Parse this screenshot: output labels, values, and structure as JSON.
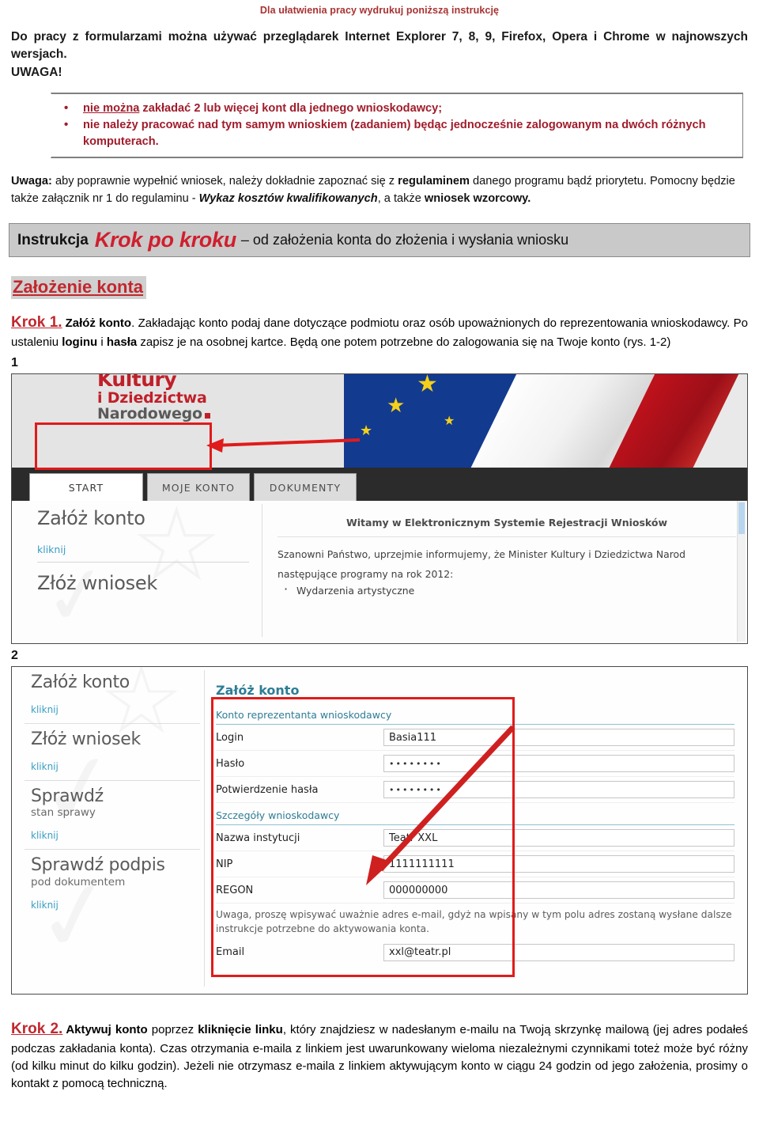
{
  "print_notice": "Dla ułatwienia pracy wydrukuj poniższą instrukcję",
  "intro": {
    "line1": "Do pracy z formularzami można używać przeglądarek Internet Explorer 7, 8, 9, Firefox, Opera i Chrome w najnowszych wersjach.",
    "uwaga": "UWAGA!"
  },
  "warning_box": {
    "bullets": [
      {
        "underlined": "nie można",
        "rest": " zakładać 2  lub więcej kont dla jednego wnioskodawcy;"
      },
      {
        "underlined": "",
        "rest": "nie należy pracować nad tym samym wnioskiem (zadaniem) będąc jednocześnie zalogowanym na dwóch różnych komputerach."
      }
    ]
  },
  "note_paragraph": {
    "label": "Uwaga:",
    "part1": " aby poprawnie wypełnić wniosek, należy dokładnie zapoznać się z ",
    "bold1": "regulaminem",
    "part2": " danego programu bądź priorytetu. Pomocny będzie także załącznik nr 1 do regulaminu - ",
    "italic1": "Wykaz kosztów kwalifikowanych",
    "part3": ", a także ",
    "bold2": "wniosek wzorcowy."
  },
  "banner": {
    "label": "Instrukcja",
    "big": "Krok po kroku",
    "tail": "– od założenia konta do złożenia i wysłania wniosku"
  },
  "section_heading": "Założenie konta",
  "step1": {
    "krok": "Krok 1.",
    "bold_title": "Załóż konto",
    "text1": ". Zakładając konto podaj dane dotyczące podmiotu oraz osób upoważnionych do reprezentowania wnioskodawcy. Po ustaleniu ",
    "bold_login": "loginu",
    "text2": " i ",
    "bold_haslo": "hasła",
    "text3": " zapisz je na osobnej kartce. Będą one potem potrzebne do zalogowania się na Twoje konto (rys. 1-2)"
  },
  "figure1": {
    "number": "1",
    "logo": {
      "line1": "Kultury",
      "line2": "i Dziedzictwa",
      "line3": "Narodowego"
    },
    "tabs": [
      {
        "label": "START",
        "active": true
      },
      {
        "label": "MOJE KONTO",
        "active": false
      },
      {
        "label": "DOKUMENTY",
        "active": false
      }
    ],
    "cards": [
      {
        "title": "Załóż konto",
        "link": "kliknij"
      },
      {
        "title": "Złóż wniosek",
        "link": ""
      }
    ],
    "right_panel": {
      "welcome": "Witamy w Elektronicznym Systemie Rejestracji Wniosków",
      "paragraph1": "Szanowni Państwo, uprzejmie informujemy, że Minister Kultury i Dziedzictwa Narod",
      "paragraph2": "następujące programy na rok 2012:",
      "item1": "Wydarzenia artystyczne"
    },
    "annotation": "red-highlight-box-around-zaloz-konto-kliknij"
  },
  "figure2": {
    "number": "2",
    "sidebar": [
      {
        "title": "Załóż konto",
        "subtitle": "",
        "link": "kliknij"
      },
      {
        "title": "Złóż wniosek",
        "subtitle": "",
        "link": "kliknij"
      },
      {
        "title": "Sprawdź",
        "subtitle": "stan sprawy",
        "link": "kliknij"
      },
      {
        "title": "Sprawdź podpis",
        "subtitle": "pod dokumentem",
        "link": "kliknij"
      }
    ],
    "form": {
      "title": "Załóż konto",
      "section1": "Konto reprezentanta wnioskodawcy",
      "section2": "Szczegóły wnioskodawcy",
      "rows_account": [
        {
          "label": "Login",
          "value": "Basia111",
          "masked": false
        },
        {
          "label": "Hasło",
          "value": "••••••••",
          "masked": true
        },
        {
          "label": "Potwierdzenie hasła",
          "value": "••••••••",
          "masked": true
        }
      ],
      "rows_details": [
        {
          "label": "Nazwa instytucji",
          "value": "Teatr XXL",
          "masked": false
        },
        {
          "label": "NIP",
          "value": "1111111111",
          "masked": false
        },
        {
          "label": "REGON",
          "value": "000000000",
          "masked": false
        }
      ],
      "note": "Uwaga, proszę wpisywać uważnie adres e-mail, gdyż na wpisany w tym polu adres zostaną wysłane dalsze instrukcje potrzebne do aktywowania konta.",
      "email_row": {
        "label": "Email",
        "value": "xxl@teatr.pl",
        "masked": false
      }
    }
  },
  "step2": {
    "krok": "Krok 2.",
    "bold_title": "Aktywuj konto",
    "text1": " poprzez ",
    "bold_link": "kliknięcie linku",
    "text2": ", który znajdziesz w nadesłanym e-mailu na Twoją skrzynkę mailową (jej adres podałeś podczas zakładania konta). Czas otrzymania e-maila z linkiem jest uwarunkowany wieloma niezależnymi czynnikami toteż może być różny (od kilku minut do kilku godzin). Jeżeli nie otrzymasz e-maila z linkiem aktywującym konto w ciągu 24 godzin od jego założenia, prosimy o kontakt z pomocą techniczną."
  },
  "colors": {
    "accent_red": "#c1272d",
    "warning_red": "#a01c2b",
    "annotation_red": "#e01b1b",
    "link_blue": "#3a9ec4",
    "form_teal": "#2e7d96",
    "banner_gray": "#c9c9c9"
  }
}
